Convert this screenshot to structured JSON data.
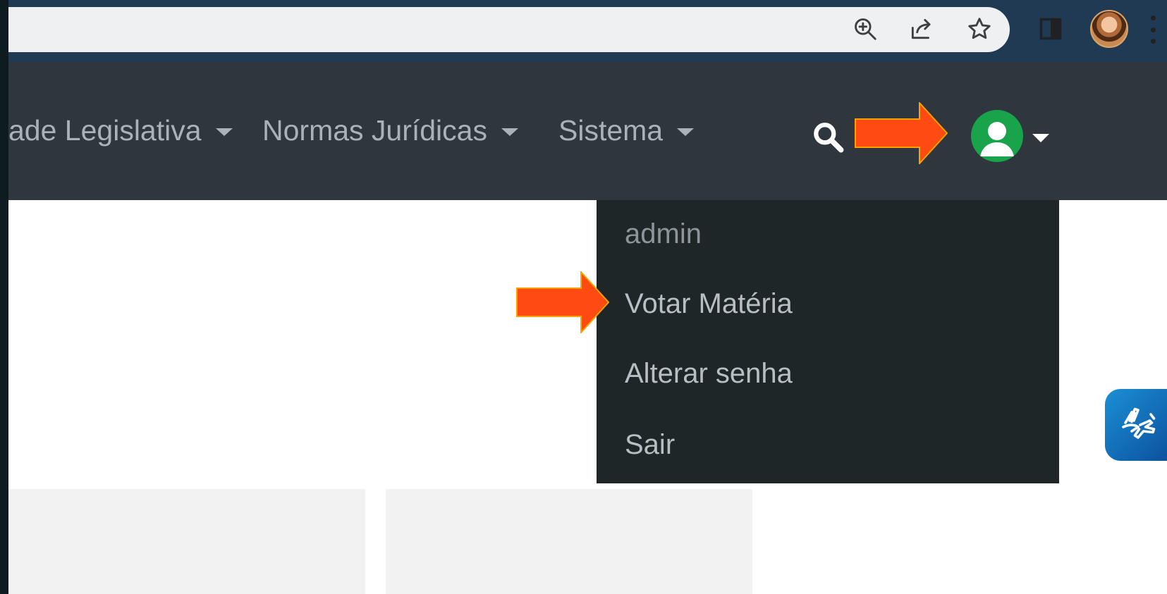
{
  "browser": {
    "toolbar_icons": [
      "zoom-icon",
      "share-icon",
      "star-icon",
      "side-panel-icon",
      "profile-avatar",
      "menu-icon"
    ]
  },
  "navbar": {
    "items": [
      {
        "label": "ade Legislativa"
      },
      {
        "label": "Normas Jurídicas"
      },
      {
        "label": "Sistema"
      }
    ],
    "search_icon": "search-icon",
    "user_icon": "user-avatar-icon"
  },
  "dropdown": {
    "header": "admin",
    "items": [
      {
        "label": "Votar Matéria"
      },
      {
        "label": "Alterar senha"
      },
      {
        "label": "Sair"
      }
    ]
  },
  "accessibility": {
    "icon": "sign-language-icon"
  },
  "colors": {
    "navbar_bg": "#30363d",
    "dropdown_bg": "#1f2628",
    "avatar_green": "#19a34a",
    "arrow_orange": "#ff4a12",
    "accessibility_blue": "#1b8fd6"
  }
}
